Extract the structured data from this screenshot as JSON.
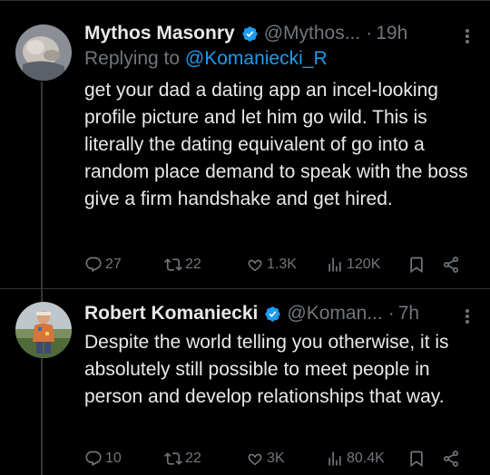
{
  "tweets": [
    {
      "name": "Mythos Masonry",
      "handle": "@Mythos...",
      "time": "19h",
      "replying_prefix": "Replying to ",
      "replying_to": "@Komaniecki_R",
      "text": "get your dad a dating app an incel-looking profile picture and let him go wild. This is literally the dating equivalent of go into a random place demand to speak with the boss give a firm handshake and get hired.",
      "stats": {
        "replies": "27",
        "retweets": "22",
        "likes": "1.3K",
        "views": "120K"
      }
    },
    {
      "name": "Robert Komaniecki",
      "handle": "@Koman...",
      "time": "7h",
      "text": "Despite the world telling you otherwise, it is absolutely still possible to meet people in person and develop relationships that way.",
      "stats": {
        "replies": "10",
        "retweets": "22",
        "likes": "3K",
        "views": "80.4K"
      }
    }
  ],
  "colors": {
    "background": "#000000",
    "text": "#e7e9ea",
    "muted": "#71767b",
    "accent": "#1d9bf0"
  },
  "icons": [
    "verified-badge-icon",
    "more-icon",
    "reply-icon",
    "retweet-icon",
    "like-icon",
    "views-icon",
    "bookmark-icon",
    "share-icon"
  ]
}
